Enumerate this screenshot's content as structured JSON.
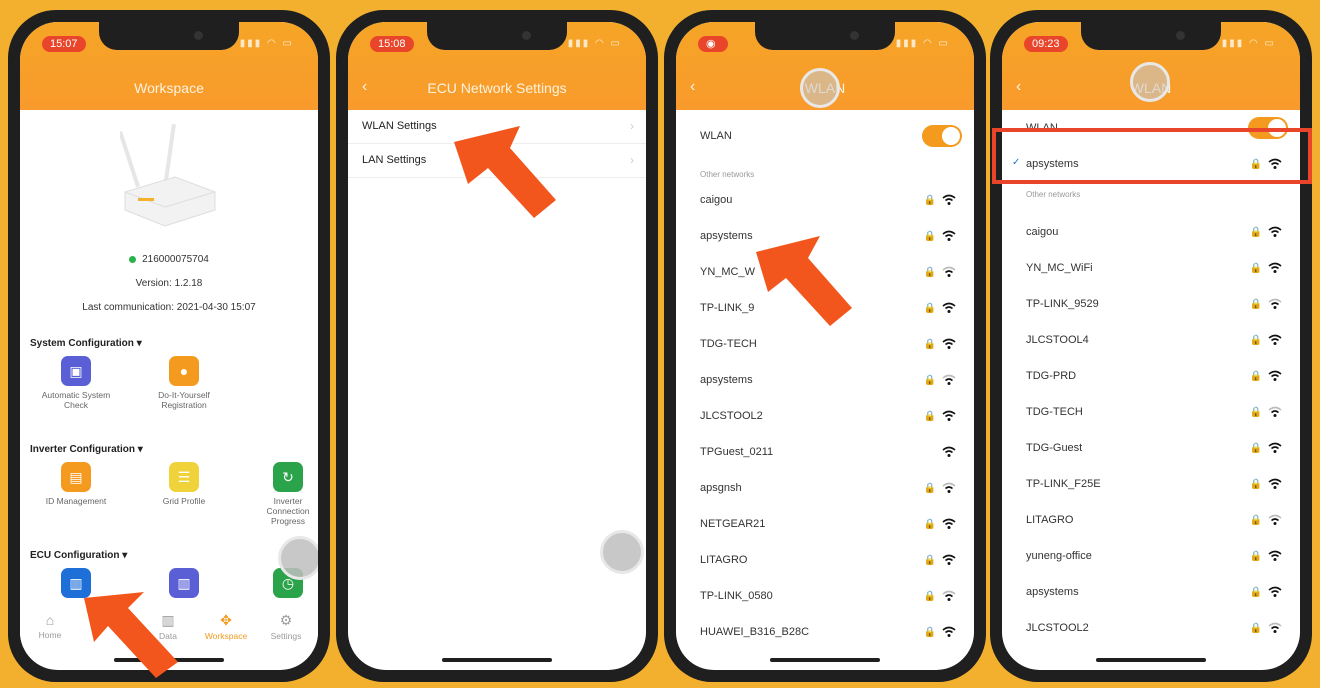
{
  "phones": [
    {
      "time": "15:07",
      "title": "Workspace",
      "device": {
        "serial": "216000075704",
        "version": "Version: 1.2.18",
        "last_comm": "Last communication: 2021-04-30 15:07"
      },
      "sections": [
        {
          "title": "System Configuration",
          "items": [
            "Automatic System Check",
            "Do-It-Yourself Registration"
          ]
        },
        {
          "title": "Inverter Configuration",
          "items": [
            "ID Management",
            "Grid Profile",
            "Inverter Connection Progress"
          ]
        },
        {
          "title": "ECU Configuration",
          "items": []
        }
      ],
      "tabs": [
        "Home",
        "Data",
        "Workspace",
        "Settings"
      ]
    },
    {
      "time": "15:08",
      "title": "ECU Network Settings",
      "menu": [
        "WLAN Settings",
        "LAN Settings"
      ]
    },
    {
      "time": "",
      "title": "WLAN",
      "wlan_label": "WLAN",
      "other_label": "Other networks",
      "networks": [
        "caigou",
        "apsystems",
        "YN_MC_W",
        "TP-LINK_9",
        "TDG-TECH",
        "apsystems",
        "JLCSTOOL2",
        "TPGuest_0211",
        "apsgnsh",
        "NETGEAR21",
        "LITAGRO",
        "TP-LINK_0580",
        "HUAWEI_B316_B28C"
      ]
    },
    {
      "time": "09:23",
      "title": "WLAN",
      "wlan_label": "WLAN",
      "connected": "apsystems",
      "other_label": "Other networks",
      "networks": [
        "caigou",
        "YN_MC_WiFi",
        "TP-LINK_9529",
        "JLCSTOOL4",
        "TDG-PRD",
        "TDG-TECH",
        "TDG-Guest",
        "TP-LINK_F25E",
        "LITAGRO",
        "yuneng-office",
        "apsystems",
        "JLCSTOOL2"
      ]
    }
  ]
}
